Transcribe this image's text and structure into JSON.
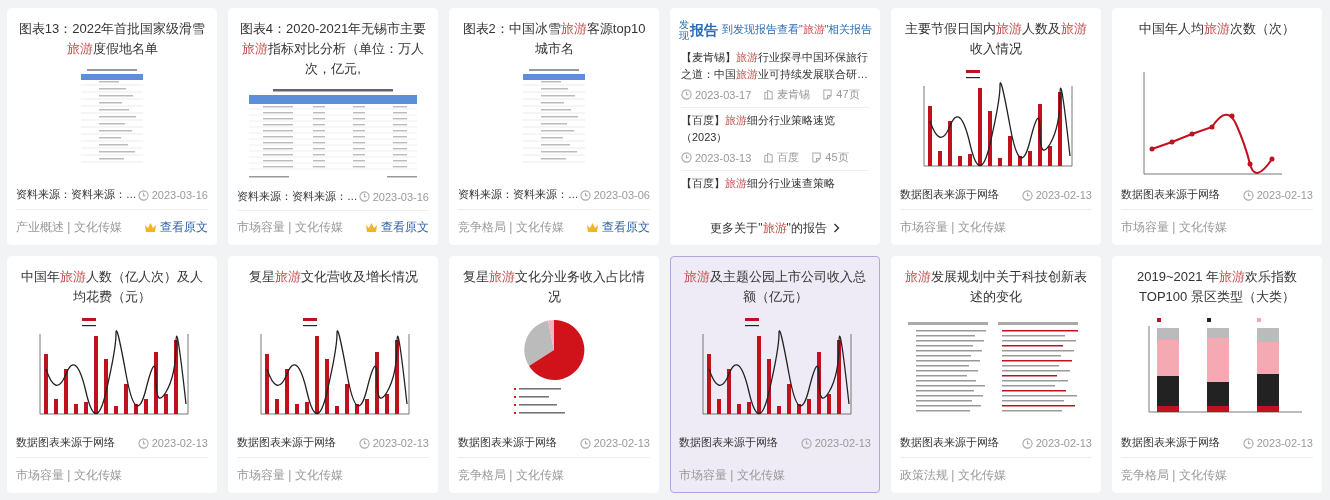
{
  "cards": [
    {
      "kind": "chart",
      "selected": false,
      "title": [
        {
          "text": "图表13：2022年首批国家级滑雪",
          "highlight": false
        },
        {
          "text": "旅游",
          "highlight": true
        },
        {
          "text": "度假地名单",
          "highlight": false
        }
      ],
      "source": "资料来源：资料来源：…",
      "date": "2023-03-16",
      "tags": "产业概述 | 文化传媒",
      "view_original": "查看原文"
    },
    {
      "kind": "chart",
      "selected": false,
      "title": [
        {
          "text": "图表4：2020-2021年无锡市主要",
          "highlight": false
        },
        {
          "text": "旅游",
          "highlight": true
        },
        {
          "text": "指标对比分析（单位：万人次，亿元,",
          "highlight": false
        }
      ],
      "source": "资料来源：资料来源：…",
      "date": "2023-03-16",
      "tags": "市场容量 | 文化传媒",
      "view_original": "查看原文"
    },
    {
      "kind": "chart",
      "selected": false,
      "title": [
        {
          "text": "图表2：中国冰雪",
          "highlight": false
        },
        {
          "text": "旅游",
          "highlight": true
        },
        {
          "text": "客源top10城市名",
          "highlight": false
        }
      ],
      "source": "资料来源：资料来源：…",
      "date": "2023-03-06",
      "tags": "竞争格局 | 文化传媒",
      "view_original": "查看原文"
    },
    {
      "kind": "reports",
      "selected": false,
      "logo_small": "发现",
      "logo_large": "报告",
      "header": [
        {
          "text": "到发现报告查看\"",
          "highlight": false
        },
        {
          "text": "旅游",
          "highlight": true
        },
        {
          "text": "\"相关报告",
          "highlight": false
        }
      ],
      "reports": [
        {
          "title": [
            {
              "text": "【麦肯锡】",
              "highlight": false
            },
            {
              "text": "旅游",
              "highlight": true
            },
            {
              "text": "行业探寻中国环保旅行之道：中国",
              "highlight": false
            },
            {
              "text": "旅游",
              "highlight": true
            },
            {
              "text": "业可持续发展联合研…",
              "highlight": false
            }
          ],
          "date": "2023-03-17",
          "publisher": "麦肯锡",
          "pages": "47页"
        },
        {
          "title": [
            {
              "text": "【百度】",
              "highlight": false
            },
            {
              "text": "旅游",
              "highlight": true
            },
            {
              "text": "细分行业策略速览（2023）",
              "highlight": false
            }
          ],
          "date": "2023-03-13",
          "publisher": "百度",
          "pages": "45页"
        },
        {
          "title": [
            {
              "text": "【百度】",
              "highlight": false
            },
            {
              "text": "旅游",
              "highlight": true
            },
            {
              "text": "细分行业速查策略",
              "highlight": false
            }
          ]
        }
      ],
      "more": [
        {
          "text": "更多关于\"",
          "highlight": false
        },
        {
          "text": "旅游",
          "highlight": true
        },
        {
          "text": "\"的报告",
          "highlight": false
        }
      ]
    },
    {
      "kind": "chart",
      "selected": false,
      "title": [
        {
          "text": "主要节假日国内",
          "highlight": false
        },
        {
          "text": "旅游",
          "highlight": true
        },
        {
          "text": "人数及",
          "highlight": false
        },
        {
          "text": "旅游",
          "highlight": true
        },
        {
          "text": "收入情况",
          "highlight": false
        }
      ],
      "source": "数据图表来源于网络",
      "date": "2023-02-13",
      "tags": "市场容量 | 文化传媒"
    },
    {
      "kind": "chart",
      "selected": false,
      "title": [
        {
          "text": "中国年人均",
          "highlight": false
        },
        {
          "text": "旅游",
          "highlight": true
        },
        {
          "text": "次数（次）",
          "highlight": false
        }
      ],
      "source": "数据图表来源于网络",
      "date": "2023-02-13",
      "tags": "市场容量 | 文化传媒"
    },
    {
      "kind": "chart",
      "selected": false,
      "title": [
        {
          "text": "中国年",
          "highlight": false
        },
        {
          "text": "旅游",
          "highlight": true
        },
        {
          "text": "人数（亿人次）及人均花费（元）",
          "highlight": false
        }
      ],
      "source": "数据图表来源于网络",
      "date": "2023-02-13",
      "tags": "市场容量 | 文化传媒"
    },
    {
      "kind": "chart",
      "selected": false,
      "title": [
        {
          "text": "复星",
          "highlight": false
        },
        {
          "text": "旅游",
          "highlight": true
        },
        {
          "text": "文化营收及增长情况",
          "highlight": false
        }
      ],
      "source": "数据图表来源于网络",
      "date": "2023-02-13",
      "tags": "市场容量 | 文化传媒"
    },
    {
      "kind": "chart",
      "selected": false,
      "title": [
        {
          "text": "复星",
          "highlight": false
        },
        {
          "text": "旅游",
          "highlight": true
        },
        {
          "text": "文化分业务收入占比情况",
          "highlight": false
        }
      ],
      "source": "数据图表来源于网络",
      "date": "2023-02-13",
      "tags": "竞争格局 | 文化传媒"
    },
    {
      "kind": "chart",
      "selected": true,
      "title": [
        {
          "text": "旅游",
          "highlight": true
        },
        {
          "text": "及主题公园上市公司收入总额（亿元）",
          "highlight": false
        }
      ],
      "source": "数据图表来源于网络",
      "date": "2023-02-13",
      "tags": "市场容量 | 文化传媒"
    },
    {
      "kind": "chart",
      "selected": false,
      "title": [
        {
          "text": "旅游",
          "highlight": true
        },
        {
          "text": "发展规划中关于科技创新表述的变化",
          "highlight": false
        }
      ],
      "source": "数据图表来源于网络",
      "date": "2023-02-13",
      "tags": "政策法规 | 文化传媒"
    },
    {
      "kind": "chart",
      "selected": false,
      "title": [
        {
          "text": "2019~2021 年",
          "highlight": false
        },
        {
          "text": "旅游",
          "highlight": true
        },
        {
          "text": "欢乐指数 TOP100 景区类型（大类）",
          "highlight": false
        }
      ],
      "source": "数据图表来源于网络",
      "date": "2023-02-13",
      "tags": "竞争格局 | 文化传媒"
    }
  ]
}
